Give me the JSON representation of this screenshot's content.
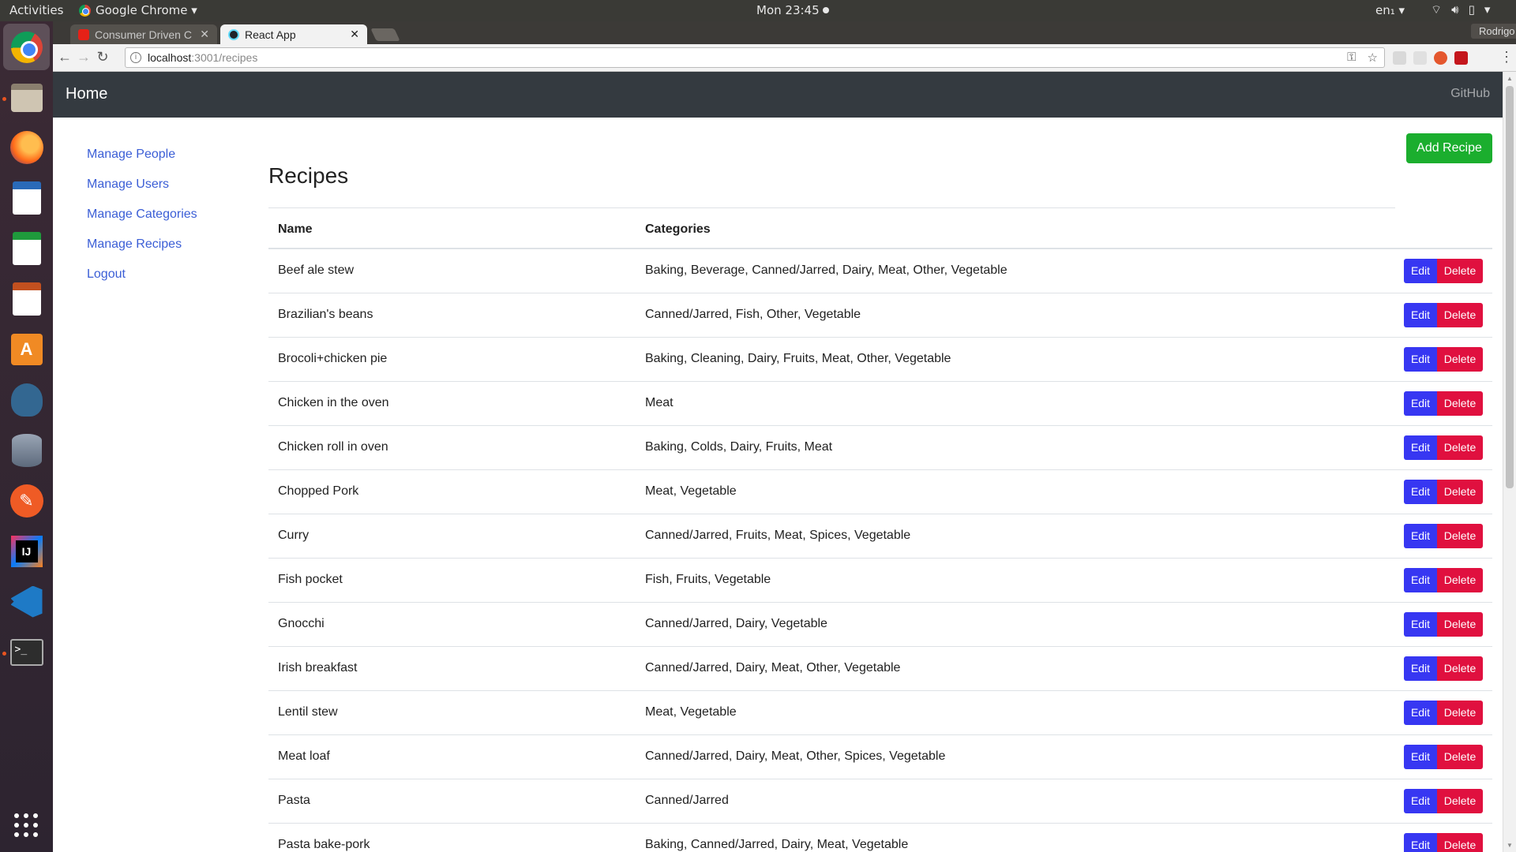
{
  "topbar": {
    "activities": "Activities",
    "app_name": "Google Chrome ▾",
    "clock": "Mon 23:45",
    "language": "en₁ ▾"
  },
  "browser": {
    "tabs": [
      {
        "title": "Consumer Driven C",
        "active": false
      },
      {
        "title": "React App",
        "active": true
      }
    ],
    "profile": "Rodrigo",
    "url_host": "localhost",
    "url_path": ":3001/recipes"
  },
  "app": {
    "brand": "Home",
    "github_link": "GitHub",
    "sidebar": [
      {
        "label": "Manage People"
      },
      {
        "label": "Manage Users"
      },
      {
        "label": "Manage Categories"
      },
      {
        "label": "Manage Recipes"
      },
      {
        "label": "Logout"
      }
    ],
    "page_title": "Recipes",
    "add_button": "Add Recipe",
    "table": {
      "headers": [
        "Name",
        "Categories",
        ""
      ],
      "edit_label": "Edit",
      "delete_label": "Delete",
      "rows": [
        {
          "name": "Beef ale stew",
          "categories": "Baking, Beverage, Canned/Jarred, Dairy, Meat, Other, Vegetable"
        },
        {
          "name": "Brazilian's beans",
          "categories": "Canned/Jarred, Fish, Other, Vegetable"
        },
        {
          "name": "Brocoli+chicken pie",
          "categories": "Baking, Cleaning, Dairy, Fruits, Meat, Other, Vegetable"
        },
        {
          "name": "Chicken in the oven",
          "categories": "Meat"
        },
        {
          "name": "Chicken roll in oven",
          "categories": "Baking, Colds, Dairy, Fruits, Meat"
        },
        {
          "name": "Chopped Pork",
          "categories": "Meat, Vegetable"
        },
        {
          "name": "Curry",
          "categories": "Canned/Jarred, Fruits, Meat, Spices, Vegetable"
        },
        {
          "name": "Fish pocket",
          "categories": "Fish, Fruits, Vegetable"
        },
        {
          "name": "Gnocchi",
          "categories": "Canned/Jarred, Dairy, Vegetable"
        },
        {
          "name": "Irish breakfast",
          "categories": "Canned/Jarred, Dairy, Meat, Other, Vegetable"
        },
        {
          "name": "Lentil stew",
          "categories": "Meat, Vegetable"
        },
        {
          "name": "Meat loaf",
          "categories": "Canned/Jarred, Dairy, Meat, Other, Spices, Vegetable"
        },
        {
          "name": "Pasta",
          "categories": "Canned/Jarred"
        },
        {
          "name": "Pasta bake-pork",
          "categories": "Baking, Canned/Jarred, Dairy, Meat, Vegetable"
        }
      ]
    }
  },
  "colors": {
    "navbar": "#343a40",
    "link": "#3b5ed6",
    "add_button": "#1bae2e",
    "edit_button": "#3737f2",
    "delete_button": "#e0103f"
  }
}
